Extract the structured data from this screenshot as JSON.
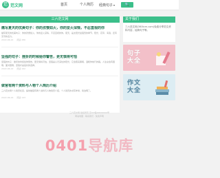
{
  "header": {
    "logo_mark": "范",
    "logo_text": "范文网",
    "nav": [
      "首页",
      "个人简历",
      "经典句子"
    ],
    "nav_arrow": "▾",
    "search_label": "🔍"
  },
  "main": {
    "section_title": "三六范文网",
    "articles": [
      {
        "title": "痛写夏天的优美句子：你的孜憬如火，你的爱火深情，不忍直视的你",
        "text": "描写夏天的优美句子：你的孜憬如火，你的爱火深情，不忍直视的你。夏天，是太阳光最强烈的季节，阳光、花草、海浪，还有无尽的活力。",
        "date": "2022-06-22",
        "views": "阅读 286"
      },
      {
        "title": "坚强的句子：挫折的时候给你警告，更无惧将可怕",
        "text": "坚强的句子：挫折的时候给你警告，更无惧将可怕，坚强是心灵深处的阳光，它会照亮黑暗，温暖你前行的路。人生总会有困难，面对困难，坚强才是最好的选择。",
        "date": "2022-06-22",
        "views": "阅读 192"
      },
      {
        "title": "做官有两个资料与人物个人简历介绍",
        "text": "三六范文网个人简历栏目，提供做官有两个资料与人物简历介绍，个人简历的书写参考，简洁明了。",
        "date": "2022-06-22",
        "views": "阅读 143"
      }
    ]
  },
  "footer": {
    "lines": [
      "三六范文网 版权所有 京ICP备00000000号",
      "网站地图 · 联系我们 · 免责声明"
    ]
  },
  "sidebar": {
    "title": "关于我们",
    "body": "三六范文网(360tcm.com)免费分享范文资料内容，经典句子等。",
    "banners": [
      {
        "text_line1": "句子",
        "text_line2": "大全",
        "color": "#f3c0c9"
      },
      {
        "text_line1": "作文",
        "text_line2": "大全",
        "color": "#ddedf3"
      }
    ]
  },
  "watermark": {
    "part_a": "0401",
    "part_b": "导航库"
  },
  "colors": {
    "accent": "#3bbf8a",
    "title_text": "#1a6e4c",
    "watermark": "#f5a0ad"
  }
}
